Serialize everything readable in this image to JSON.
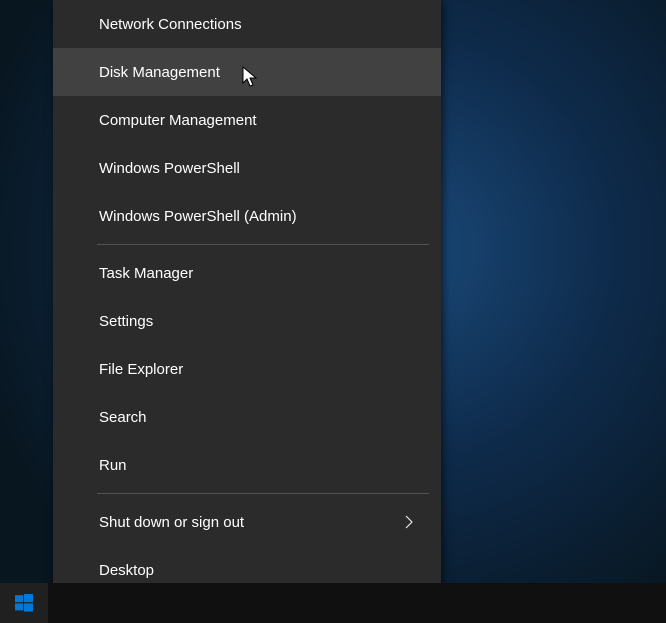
{
  "menu": {
    "group1": [
      {
        "label": "Network Connections"
      },
      {
        "label": "Disk Management",
        "hovered": true
      },
      {
        "label": "Computer Management"
      },
      {
        "label": "Windows PowerShell"
      },
      {
        "label": "Windows PowerShell (Admin)"
      }
    ],
    "group2": [
      {
        "label": "Task Manager"
      },
      {
        "label": "Settings"
      },
      {
        "label": "File Explorer"
      },
      {
        "label": "Search"
      },
      {
        "label": "Run"
      }
    ],
    "group3": [
      {
        "label": "Shut down or sign out",
        "submenu": true
      },
      {
        "label": "Desktop"
      }
    ]
  }
}
